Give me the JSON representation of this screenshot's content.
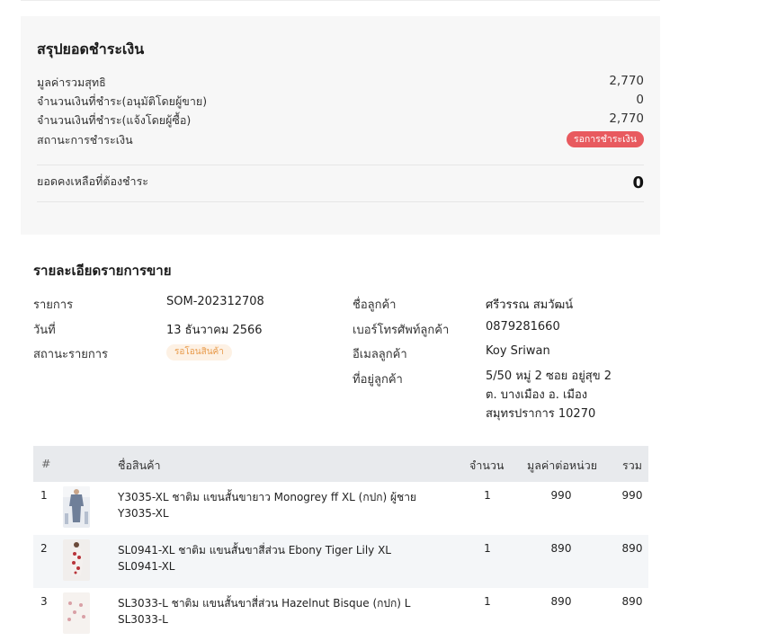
{
  "summary": {
    "title": "สรุปยอดชำระเงิน",
    "net_total_label": "มูลค่ารวมสุทธิ",
    "net_total_value": "2,770",
    "paid_approved_label": "จำนวนเงินที่ชำระ(อนุมัติโดยผู้ขาย)",
    "paid_approved_value": "0",
    "paid_reported_label": "จำนวนเงินที่ชำระ(แจ้งโดยผู้ซื้อ)",
    "paid_reported_value": "2,770",
    "payment_status_label": "สถานะการชำระเงิน",
    "payment_status_value": "รอการชำระเงิน",
    "balance_label": "ยอดคงเหลือที่ต้องชำระ",
    "balance_value": "0",
    "status_color": "#e85a5f"
  },
  "details": {
    "title": "รายละเอียดรายการขาย",
    "order_label": "รายการ",
    "order_value": "SOM-202312708",
    "date_label": "วันที่",
    "date_value": "13 ธันวาคม 2566",
    "status_label": "สถานะรายการ",
    "status_value": "รอโอนสินค้า",
    "customer_name_label": "ชื่อลูกค้า",
    "customer_name_value": "ศรีวรรณ สมวัฒน์",
    "phone_label": "เบอร์โทรศัพท์ลูกค้า",
    "phone_value": "0879281660",
    "email_label": "อีเมลลูกค้า",
    "email_value": "Koy Sriwan",
    "address_label": "ที่อยู่ลูกค้า",
    "address_lines": [
      "5/50 หมู่ 2 ซอย อยู่สุข 2",
      "ต. บางเมือง อ. เมือง",
      "สมุทรปราการ 10270"
    ]
  },
  "table": {
    "headers": {
      "index": "#",
      "name": "ชื่อสินค้า",
      "qty": "จำนวน",
      "unit_price": "มูลค่าต่อหน่วย",
      "total": "รวม"
    },
    "rows": [
      {
        "index": "1",
        "name": "Y3035-XL ชาติม แขนสั้นขายาว Monogrey ff XL (กปก) ผู้ชาย",
        "sku": "Y3035-XL",
        "qty": "1",
        "unit_price": "990",
        "total": "990"
      },
      {
        "index": "2",
        "name": "SL0941-XL ชาติม แขนสั้นขาสี่ส่วน Ebony Tiger Lily XL",
        "sku": "SL0941-XL",
        "qty": "1",
        "unit_price": "890",
        "total": "890"
      },
      {
        "index": "3",
        "name": "SL3033-L ชาติม แขนสั้นขาสี่ส่วน Hazelnut Bisque (กปก) L",
        "sku": "SL3033-L",
        "qty": "1",
        "unit_price": "890",
        "total": "890"
      }
    ]
  }
}
